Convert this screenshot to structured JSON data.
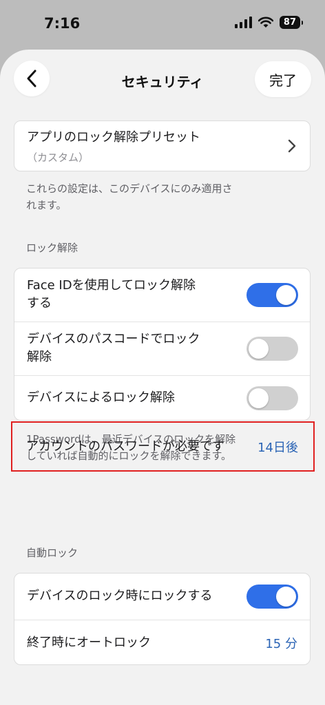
{
  "status_bar": {
    "time": "7:16",
    "battery": "87"
  },
  "nav": {
    "title": "セキュリティ",
    "done_label": "完了"
  },
  "preset": {
    "label": "アプリのロック解除プリセット",
    "sub": "（カスタム）"
  },
  "device_note": {
    "line1": "これらの設定は、このデバイスにのみ適用さ",
    "line2": "れます。"
  },
  "unlock_section": {
    "header": "ロック解除",
    "rows": [
      {
        "line1": "Face IDを使用してロック解除",
        "line2": "する",
        "enabled": true
      },
      {
        "line1": "デバイスのパスコードでロック",
        "line2": "解除",
        "enabled": false
      },
      {
        "line1": "デバイスによるロック解除",
        "enabled": false
      }
    ],
    "note_line1": "1Passwordは、最近デバイスのロックを解除",
    "note_line2": "していれば自動的にロックを解除できます。"
  },
  "require_password": {
    "label": "アカウントのパスワードが必要です",
    "value": "14日後"
  },
  "autolock_section": {
    "header": "自動ロック",
    "rows": [
      {
        "label": "デバイスのロック時にロックする",
        "enabled": true
      },
      {
        "label": "終了時にオートロック",
        "value": "15 分"
      }
    ]
  },
  "colors": {
    "accent": "#2f6fe8",
    "value_blue": "#2b64b5",
    "highlight": "#e02020"
  }
}
